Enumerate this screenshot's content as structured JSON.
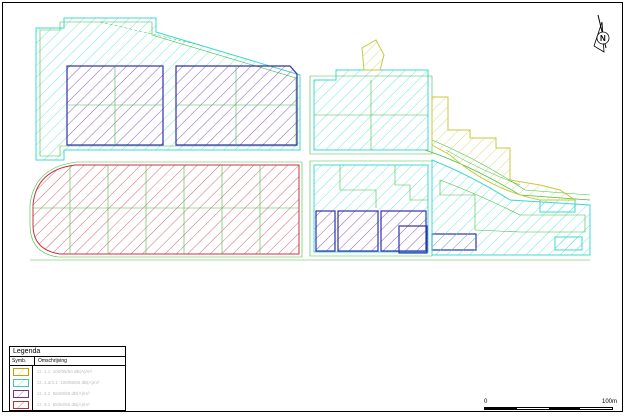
{
  "legend": {
    "title": "Legenda",
    "col_symbol": "Symb.",
    "col_description": "Omschrijving",
    "rows": [
      {
        "code": "zz. 1.1",
        "text": "100/95/60 dB(A)/m²",
        "color": "#c8c800",
        "hatch": "#d8d860"
      },
      {
        "code": "zz. 1.2/4.1",
        "text": "100/95/60 dB(A)/m²",
        "color": "#40c8c0",
        "hatch": "#60e0d8"
      },
      {
        "code": "zz. 4.2",
        "text": "65/60/55 dB(A)/m²",
        "color": "#7030a0",
        "hatch": "#c040c0"
      },
      {
        "code": "zz. 5.1",
        "text": "65/60/55 dB(A)/m²",
        "color": "#c03030",
        "hatch": "#d04050"
      }
    ]
  },
  "scale": {
    "start": "0",
    "end": "100m"
  },
  "north_arrow": {
    "label": "N",
    "icon": "north-arrow-icon"
  },
  "colors": {
    "cyan_zone": "#40d8d0",
    "green_line": "#40c040",
    "yellow_zone": "#c8c840",
    "magenta_zone": "#c040c0",
    "red_zone": "#c83040",
    "blue_outline": "#3030b0"
  }
}
